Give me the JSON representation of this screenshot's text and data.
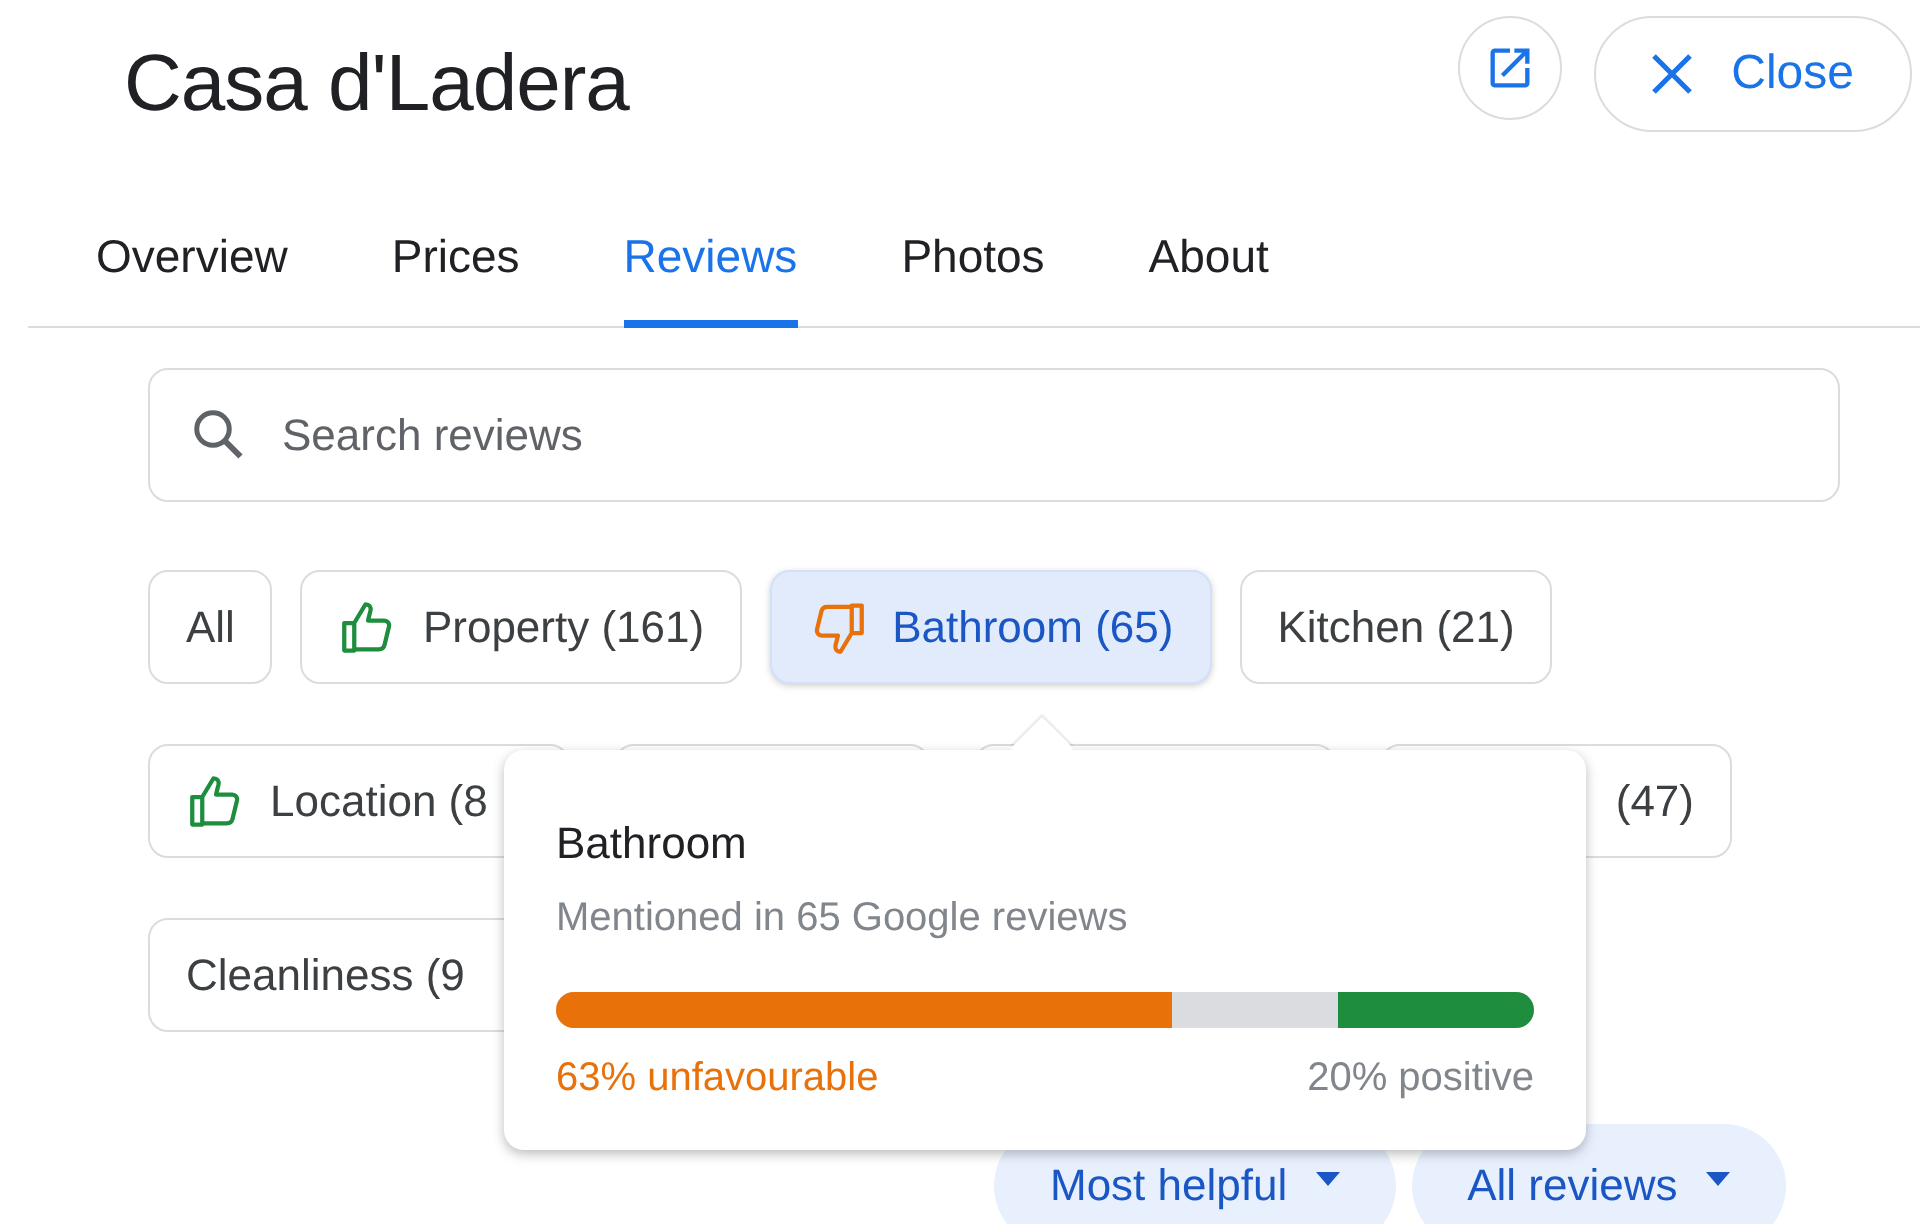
{
  "title": "Casa d'Ladera",
  "header_buttons": {
    "close": "Close"
  },
  "tabs": [
    {
      "label": "Overview",
      "selected": false
    },
    {
      "label": "Prices",
      "selected": false
    },
    {
      "label": "Reviews",
      "selected": true
    },
    {
      "label": "Photos",
      "selected": false
    },
    {
      "label": "About",
      "selected": false
    }
  ],
  "search": {
    "placeholder": "Search reviews"
  },
  "chip_rows": [
    [
      {
        "label": "All",
        "kind": "plain",
        "selected": false
      },
      {
        "label": "Property (161)",
        "kind": "thumbs-up",
        "selected": false
      },
      {
        "label": "Bathroom (65)",
        "kind": "thumbs-down",
        "selected": true
      },
      {
        "label": "Kitchen (21)",
        "kind": "plain",
        "selected": false
      }
    ],
    [
      {
        "label": "Location (8",
        "kind": "thumbs-up",
        "selected": false
      },
      {
        "kind": "plain",
        "selected": false
      },
      {
        "kind": "plain",
        "selected": false
      },
      {
        "label": "(47)",
        "kind": "plain",
        "selected": false
      }
    ],
    [
      {
        "label": "Cleanliness (9",
        "kind": "plain",
        "selected": false
      }
    ]
  ],
  "popover": {
    "title": "Bathroom",
    "subtitle": "Mentioned in 65 Google reviews",
    "unfavourable": {
      "level": 0.63,
      "text": "63% unfavourable"
    },
    "positive": {
      "level": 0.2,
      "text": "20% positive"
    }
  },
  "sort_buttons": [
    "Most helpful",
    "All reviews"
  ]
}
